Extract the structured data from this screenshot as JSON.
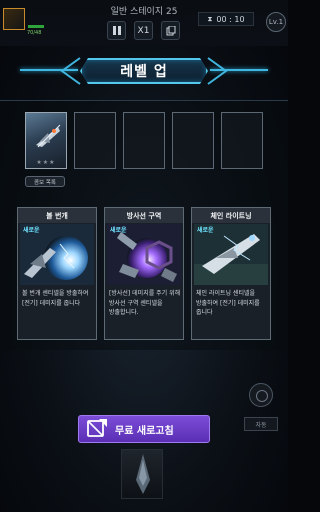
{
  "hud": {
    "stage": "일반 스테이지 25",
    "hp": "70/48",
    "speed": "X1",
    "timer_icon": "hourglass-icon",
    "timer": "00 : 10",
    "level": "Lv.1"
  },
  "title": "레벨 업",
  "slots": {
    "filled_stars": "★★★",
    "combo_label": "콤보 목록"
  },
  "cards": [
    {
      "name": "볼 번개",
      "badge": "새로운",
      "desc": "볼 번개 센티넬을 방출하여 [전기] 데미지를 줍니다"
    },
    {
      "name": "방사선 구역",
      "badge": "새로운",
      "desc": "[방사선] 데미지를 주기 위해 방사선 구역 센티넬을 방출합니다."
    },
    {
      "name": "체인 라이트닝",
      "badge": "새로운",
      "desc": "체인 라이트닝 센티넬을 방출하여 [전기] 데미지를 줍니다"
    }
  ],
  "refresh": {
    "label": "무료 새로고침",
    "icon": "refresh-card-icon"
  },
  "auto_label": "자동",
  "colors": {
    "accent": "#54c8ec",
    "refresh": "#6a3cc6",
    "new_badge": "#6fe3ff"
  }
}
